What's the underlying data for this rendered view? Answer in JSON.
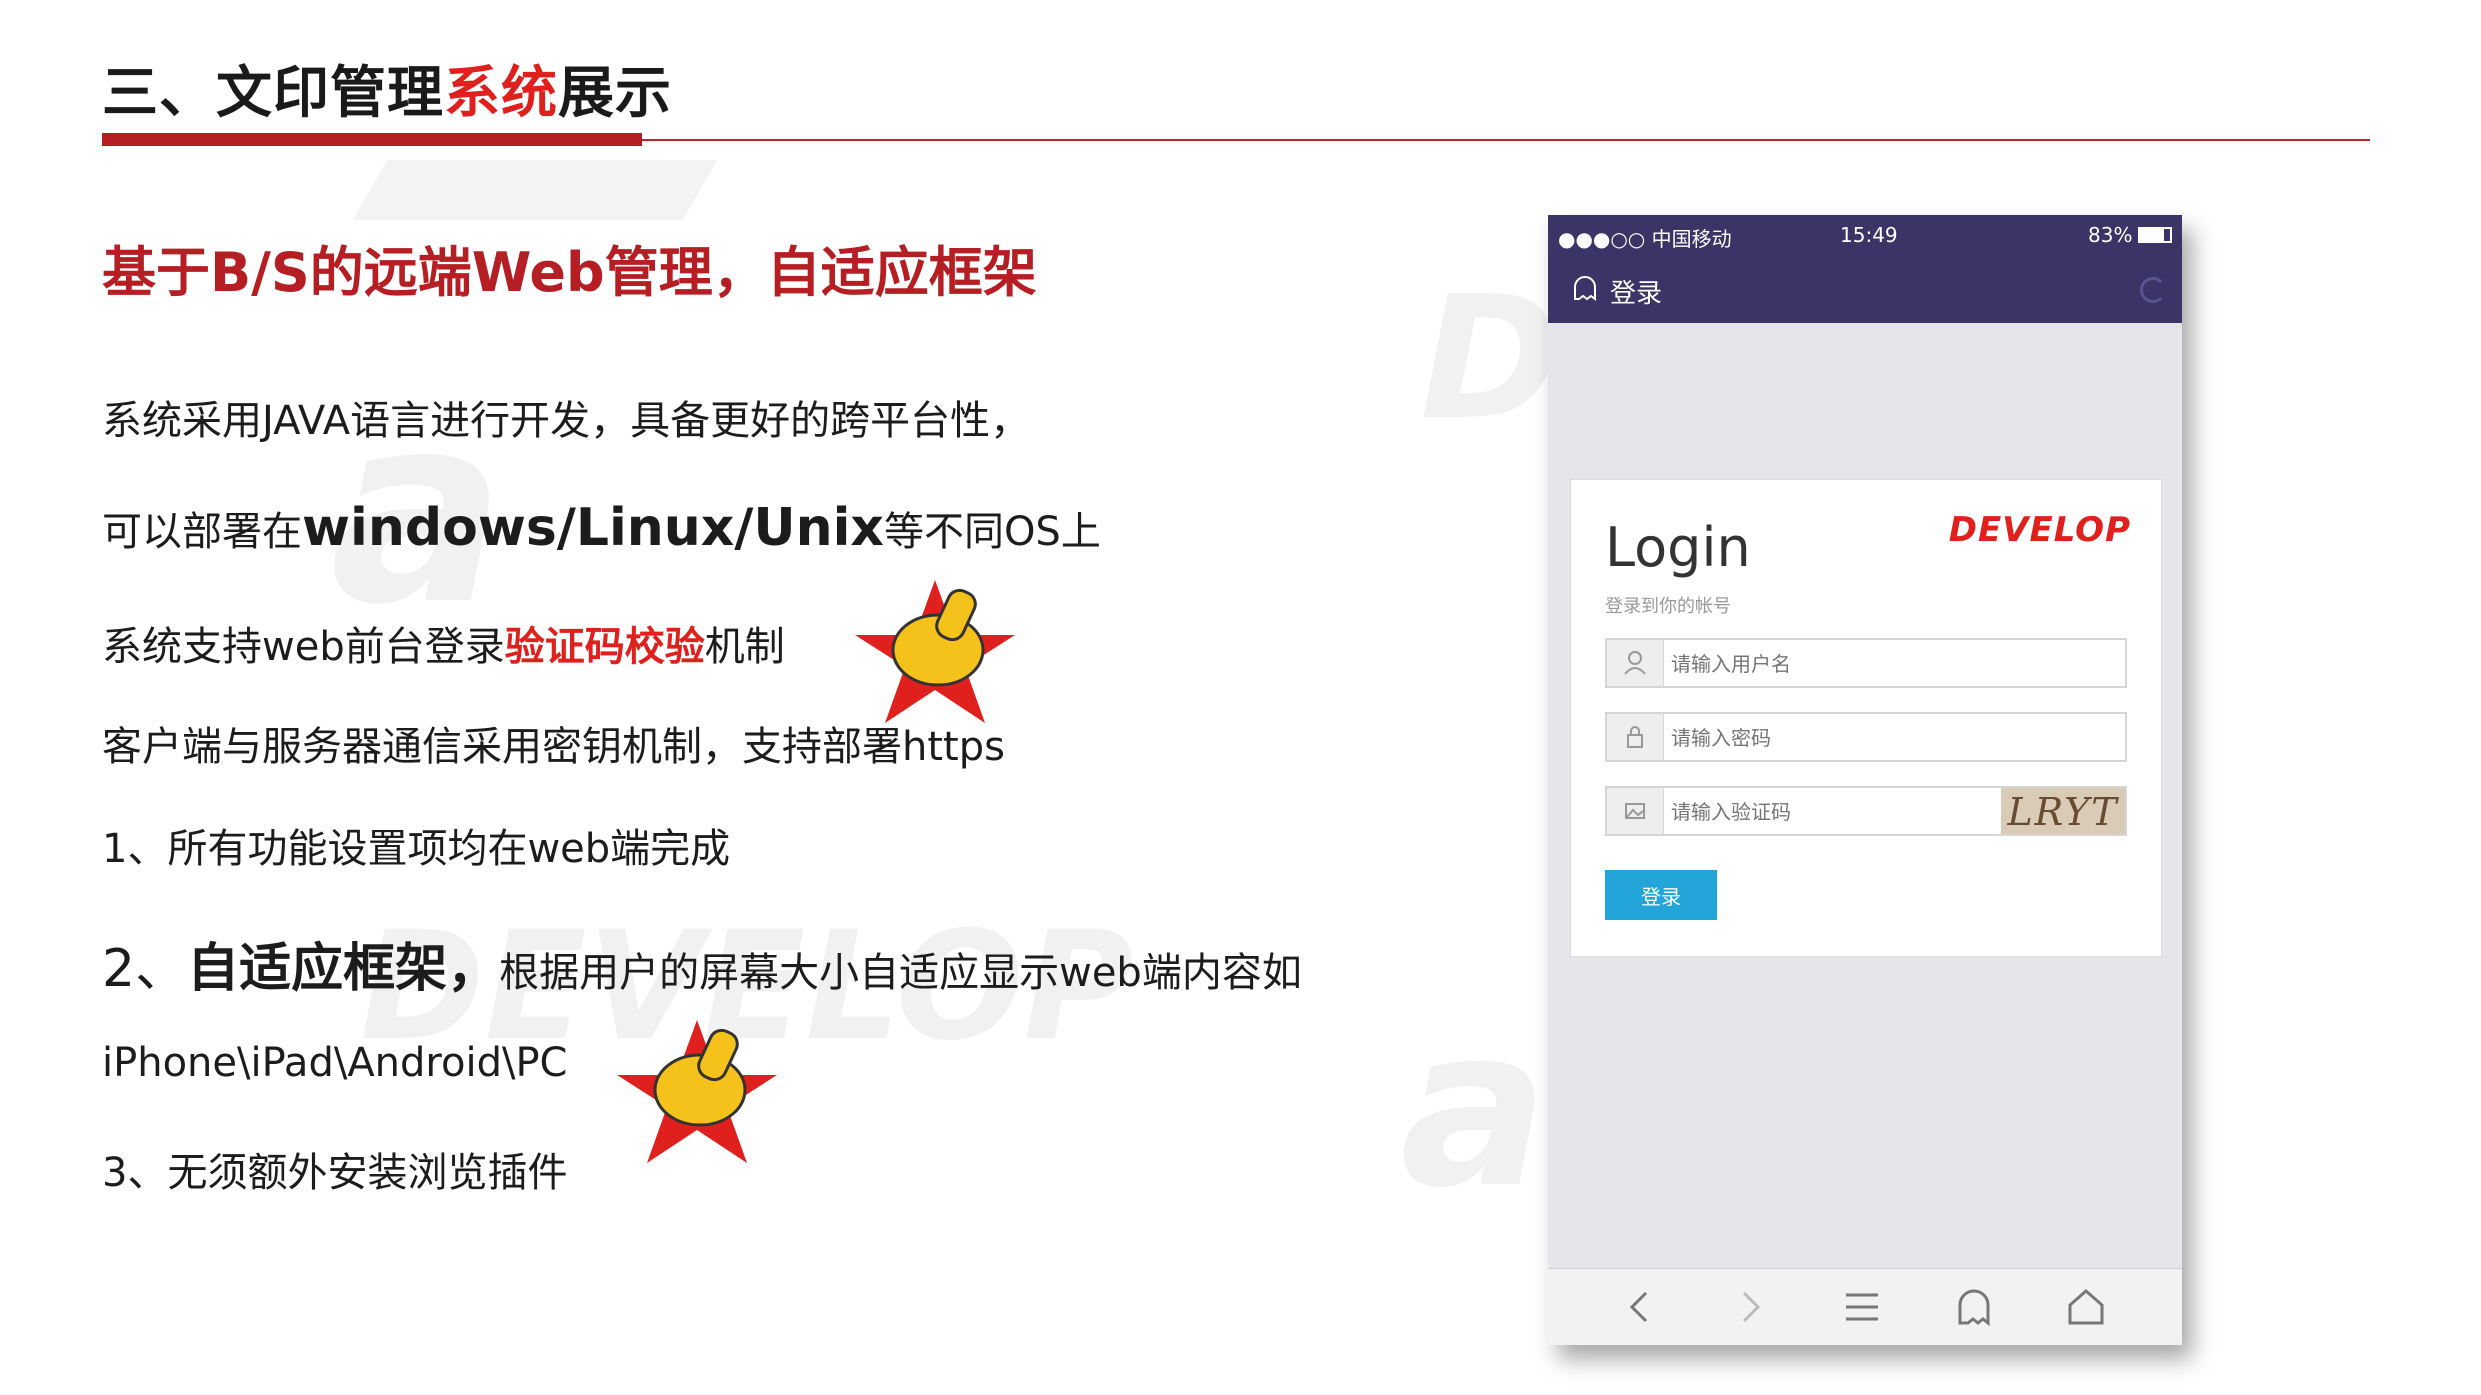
{
  "header": {
    "title_part1": "三、文印管理",
    "title_red": "系统",
    "title_part2": "展示"
  },
  "subtitle": "基于B/S的远端Web管理，自适应框架",
  "content": {
    "line1": "系统采用JAVA语言进行开发，具备更好的跨平台性，",
    "line2_a": "可以部署在",
    "line2_b": "windows/Linux/Unix",
    "line2_c": "等不同OS上",
    "line3_a": "系统支持web前台登录",
    "line3_b": "验证码校验",
    "line3_c": "机制",
    "line4": "客户端与服务器通信采用密钥机制，支持部署https",
    "line5": "1、所有功能设置项均在web端完成",
    "line6_a": "2、",
    "line6_b": "自适应框架，",
    "line6_c": "根据用户的屏幕大小自适应显示web端内容如",
    "line7": "iPhone\\iPad\\Android\\PC",
    "line8": "3、无须额外安装浏览插件"
  },
  "phone": {
    "status": {
      "carrier": "●●●○○ 中国移动",
      "time": "15:49",
      "battery": "83%"
    },
    "app_title": "登录",
    "login": {
      "heading": "Login",
      "sub": "登录到你的帐号",
      "brand": "DEVELOP",
      "username_placeholder": "请输入用户名",
      "password_placeholder": "请输入密码",
      "captcha_placeholder": "请输入验证码",
      "captcha_text": "LRYT",
      "button": "登录"
    }
  },
  "colors": {
    "accent_red": "#e0201c",
    "dark_red": "#b51f24",
    "app_bar": "#3a3566",
    "button_blue": "#24a5da"
  },
  "icons": [
    "user-icon",
    "lock-icon",
    "image-icon",
    "back-icon",
    "forward-icon",
    "menu-icon",
    "ghost-icon",
    "home-icon",
    "thumbs-up-icon"
  ]
}
